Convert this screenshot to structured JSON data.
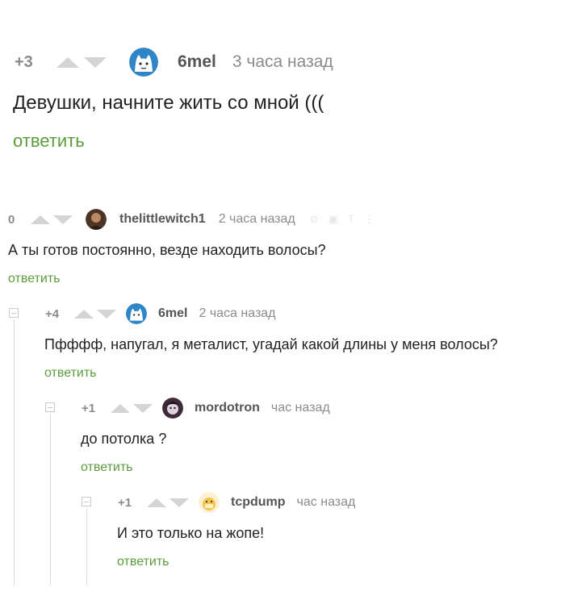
{
  "top_comment": {
    "rating": "+3",
    "author": "6mel",
    "time": "3 часа назад",
    "text": "Девушки, начните жить со мной (((",
    "reply_label": "ответить",
    "avatar_icon": "cat-avatar-icon"
  },
  "thread": [
    {
      "rating": "0",
      "author": "thelittlewitch1",
      "time": "2 часа назад",
      "text": "А ты готов постоянно, везде находить волосы?",
      "reply_label": "ответить",
      "avatar_icon": "photo-avatar-icon",
      "hover_icons": [
        "link-icon",
        "save-icon",
        "text-icon",
        "more-icon"
      ]
    },
    {
      "rating": "+4",
      "author": "6mel",
      "time": "2 часа назад",
      "text": "Пфффф, напугал, я металист, угадай какой длины у меня волосы?",
      "reply_label": "ответить",
      "avatar_icon": "cat-avatar-icon"
    },
    {
      "rating": "+1",
      "author": "mordotron",
      "time": "час назад",
      "text": "до потолка ?",
      "reply_label": "ответить",
      "avatar_icon": "face-avatar-icon"
    },
    {
      "rating": "+1",
      "author": "tcpdump",
      "time": "час назад",
      "text": "И это только на жопе!",
      "reply_label": "ответить",
      "avatar_icon": "cartoon-avatar-icon"
    }
  ],
  "colors": {
    "reply_green": "#5b9c3c",
    "muted_gray": "#8b8b8b",
    "arrow_gray": "#d4d4d4"
  }
}
